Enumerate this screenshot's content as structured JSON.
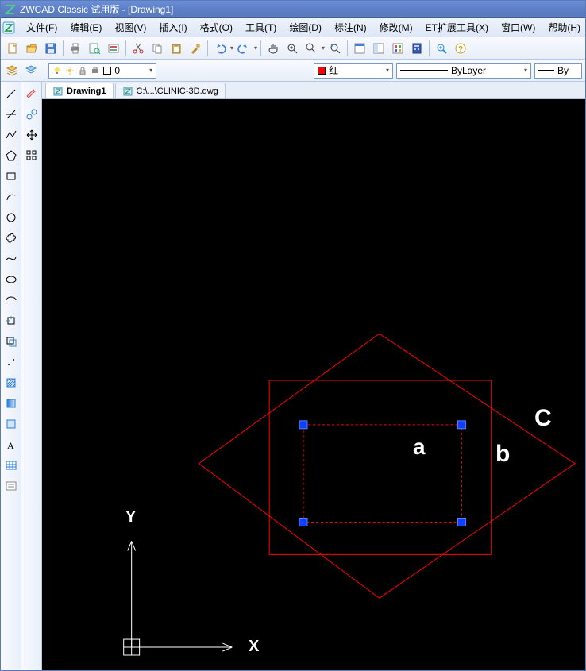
{
  "title": "ZWCAD Classic 试用版 - [Drawing1]",
  "menus": {
    "file": "文件(F)",
    "edit": "编辑(E)",
    "view": "视图(V)",
    "insert": "插入(I)",
    "format": "格式(O)",
    "tools": "工具(T)",
    "draw": "绘图(D)",
    "dim": "标注(N)",
    "modify": "修改(M)",
    "ext": "ET扩展工具(X)",
    "window": "窗口(W)",
    "help": "帮助(H)"
  },
  "layer_field": "0",
  "color_combo": {
    "swatch": "#ff0000",
    "label": "红"
  },
  "linetype_combo": {
    "label": "ByLayer"
  },
  "lineweight_combo": {
    "label": "By"
  },
  "tabs": [
    {
      "label": "Drawing1",
      "active": true
    },
    {
      "label": "C:\\...\\CLINIC-3D.dwg",
      "active": false
    }
  ],
  "ucs": {
    "x_label": "X",
    "y_label": "Y"
  },
  "annotations": {
    "a": "a",
    "b": "b",
    "c": "C"
  }
}
